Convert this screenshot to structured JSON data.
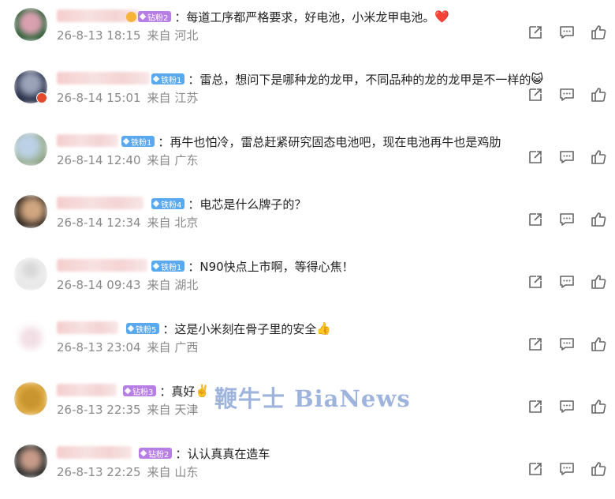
{
  "comments": [
    {
      "fan": "钻粉2",
      "fan_type": "drill",
      "crown": true,
      "text": "：每道工序都严格要求，好电池，小米龙甲电池。",
      "emoji": "❤️",
      "time": "26-8-13 18:15",
      "loc": "来自 河北"
    },
    {
      "fan": "铁粉1",
      "fan_type": "iron",
      "crown": false,
      "text": "：雷总，想问下是哪种龙的龙甲，不同品种的龙的龙甲是不一样的",
      "emoji": "😺",
      "time": "26-8-14 15:01",
      "loc": "来自 江苏"
    },
    {
      "fan": "铁粉1",
      "fan_type": "iron",
      "crown": false,
      "text": "：再牛也怕冷，雷总赶紧研究固态电池吧，现在电池再牛也是鸡肋",
      "emoji": "",
      "time": "26-8-14 12:40",
      "loc": "来自 广东"
    },
    {
      "fan": "铁粉4",
      "fan_type": "iron",
      "crown": false,
      "text": "：电芯是什么牌子的？",
      "emoji": "",
      "time": "26-8-14 12:34",
      "loc": "来自 北京"
    },
    {
      "fan": "铁粉1",
      "fan_type": "iron",
      "crown": false,
      "text": "：N90快点上市啊，等得心焦！",
      "emoji": "",
      "time": "26-8-14 09:43",
      "loc": "来自 湖北"
    },
    {
      "fan": "铁粉5",
      "fan_type": "iron",
      "crown": false,
      "text": "：这是小米刻在骨子里的安全",
      "emoji": "👍",
      "time": "26-8-13 23:04",
      "loc": "来自 广西"
    },
    {
      "fan": "钻粉3",
      "fan_type": "drill",
      "crown": false,
      "text": "：真好",
      "emoji": "✌️",
      "time": "26-8-13 22:35",
      "loc": "来自 天津"
    },
    {
      "fan": "钻粉2",
      "fan_type": "drill",
      "crown": false,
      "text": "：认认真真在造车",
      "emoji": "",
      "time": "26-8-13 22:25",
      "loc": "来自 山东"
    }
  ],
  "watermark": "鞭牛士 BiaNews",
  "icons": [
    "share-icon",
    "comment-icon",
    "like-icon"
  ],
  "colors": {
    "iron_badge": "#5aa9ef",
    "drill_badge": "#b77ee6",
    "meta_text": "#8a8a8a",
    "text": "#222222"
  }
}
